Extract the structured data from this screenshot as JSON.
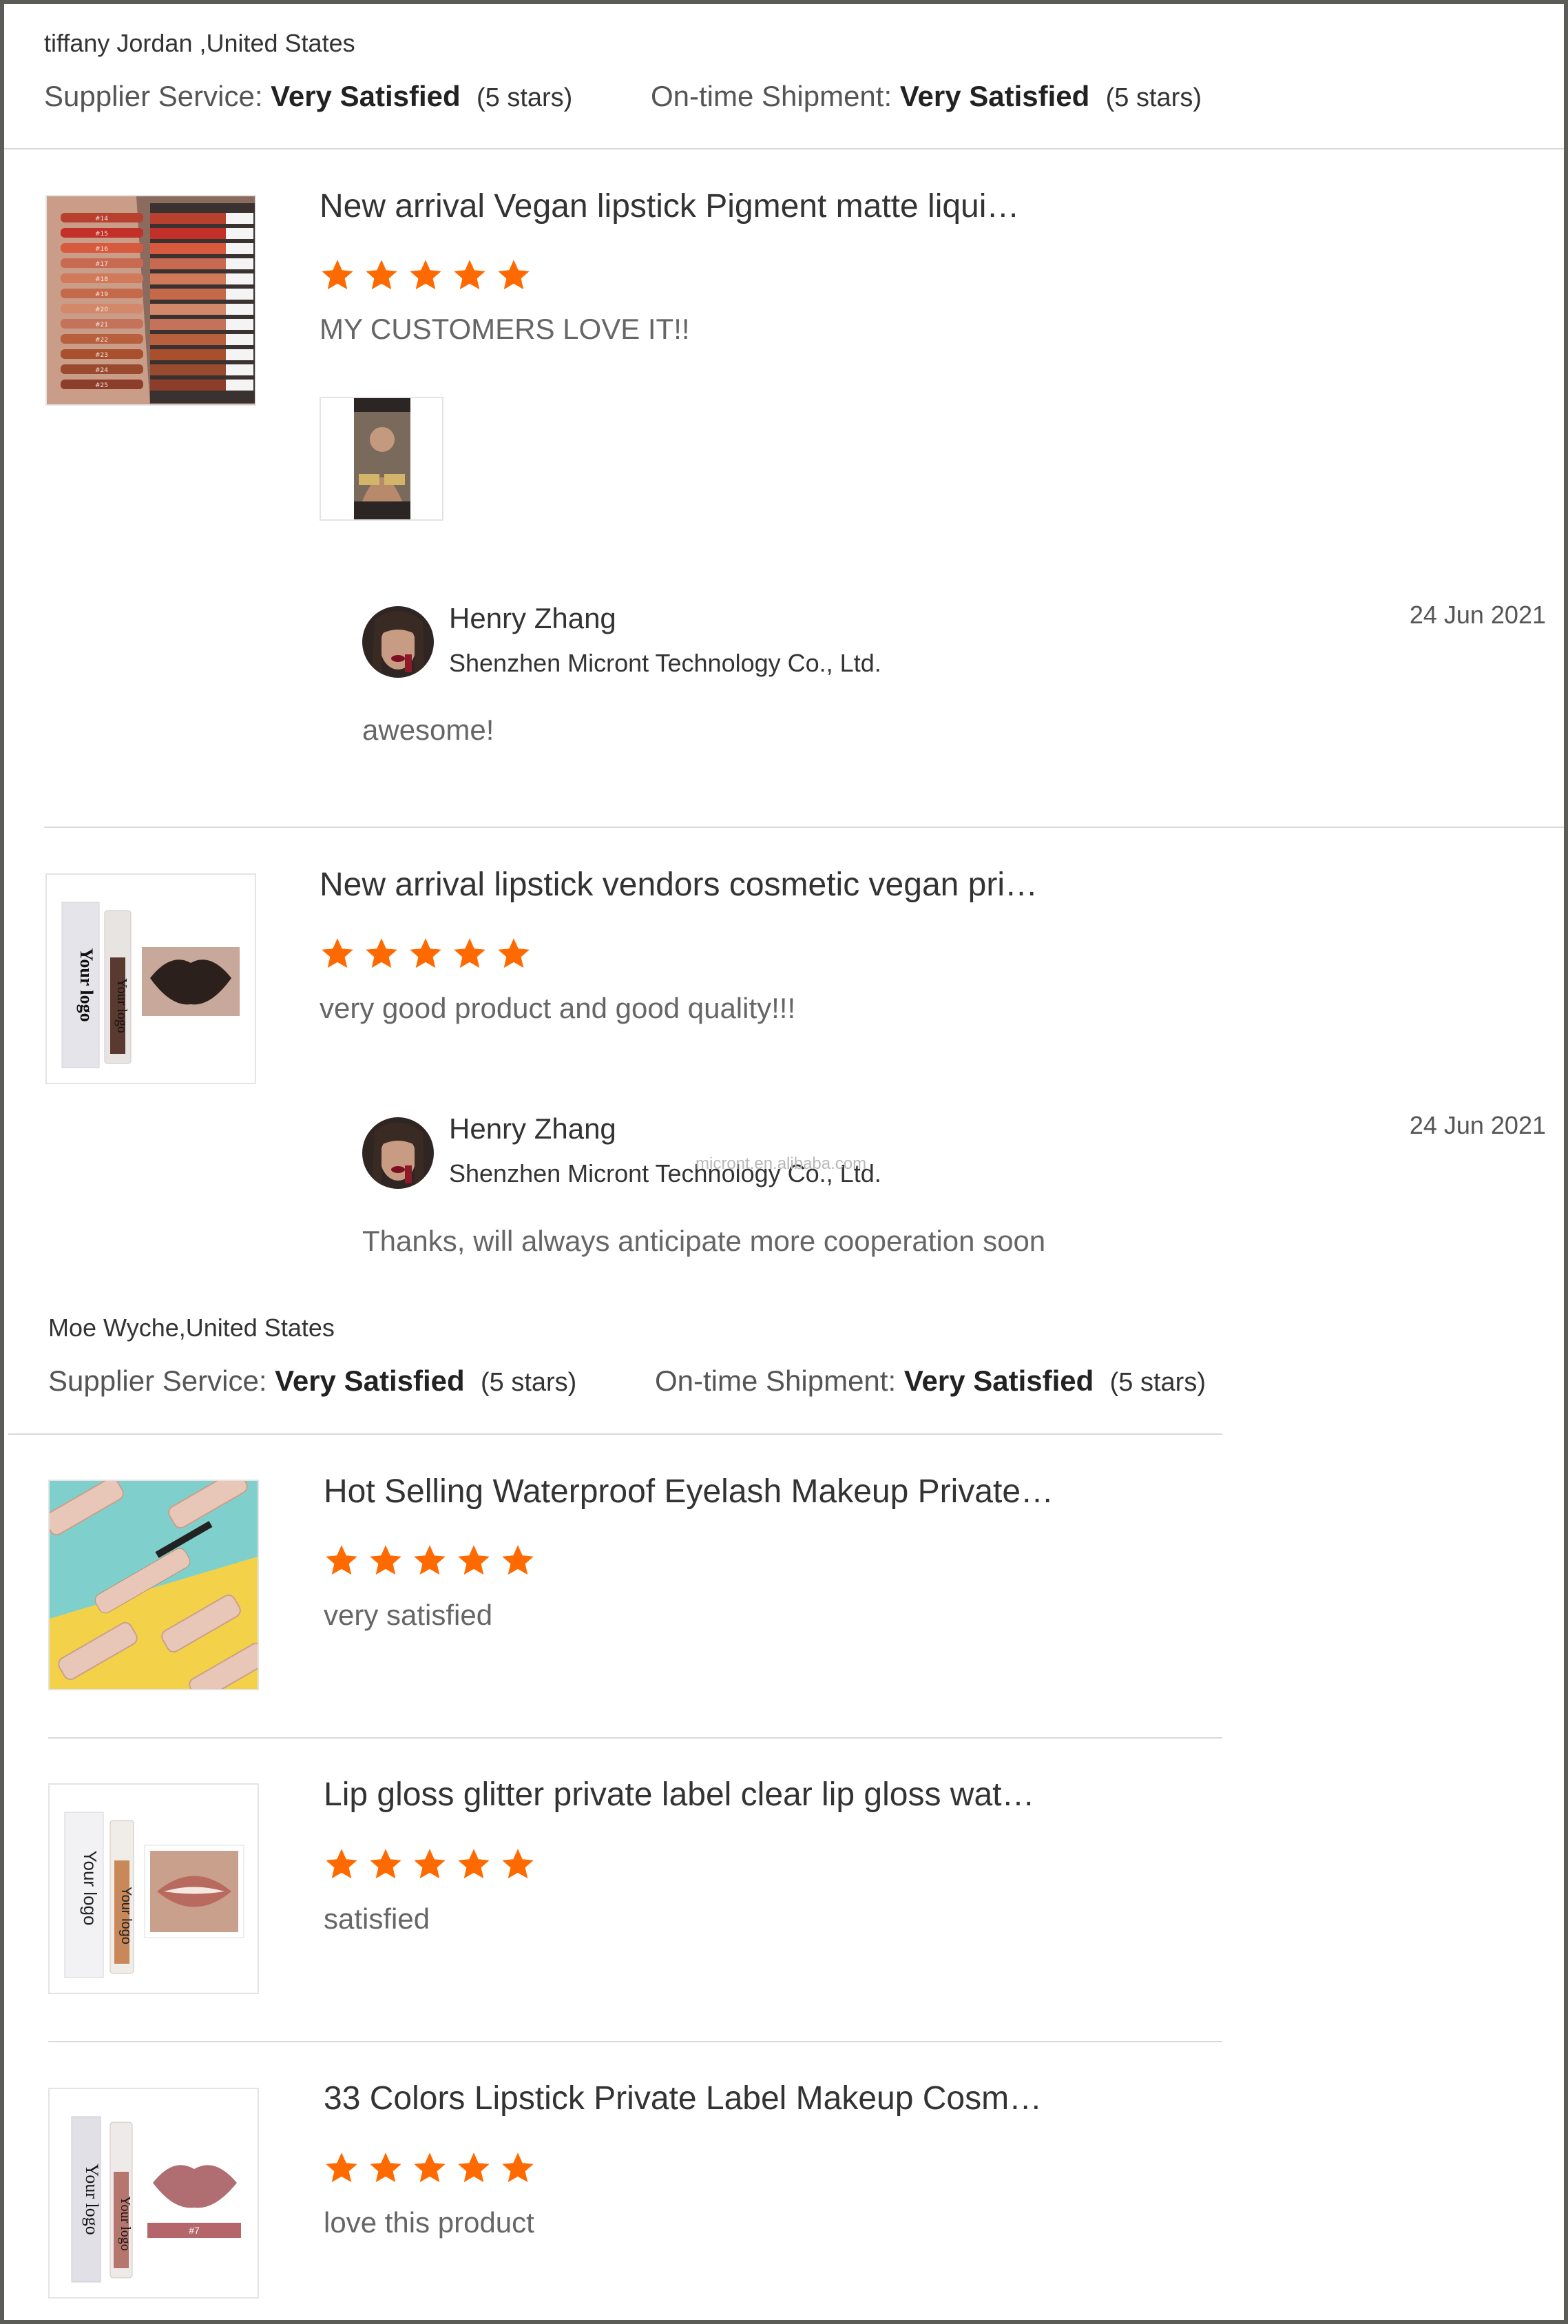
{
  "colors": {
    "star": "#ff6a00",
    "divider": "#d9d9d9",
    "border": "#5b5b58"
  },
  "reviews": [
    {
      "buyer": "tiffany Jordan ,United States",
      "supplier_label": "Supplier Service:",
      "supplier_value": "Very Satisfied",
      "supplier_stars": "(5 stars)",
      "shipment_label": "On-time Shipment:",
      "shipment_value": "Very Satisfied",
      "shipment_stars": "(5 stars)",
      "items": [
        {
          "title": "New arrival Vegan lipstick Pigment matte liqui…",
          "rating": 5,
          "comment": "MY CUSTOMERS LOVE IT!!",
          "reply": {
            "name": "Henry Zhang",
            "company": "Shenzhen Micront Technology Co., Ltd.",
            "date": "24 Jun 2021",
            "text": "awesome!"
          }
        },
        {
          "title": "New arrival lipstick vendors cosmetic vegan pri…",
          "rating": 5,
          "comment": "very good product and good quality!!!",
          "reply": {
            "name": "Henry Zhang",
            "company": "Shenzhen Micront Technology Co., Ltd.",
            "date": "24 Jun 2021",
            "text": "Thanks, will always anticipate more cooperation soon",
            "watermark": "micront.en.alibaba.com"
          }
        }
      ]
    },
    {
      "buyer": "Moe Wyche,United States",
      "supplier_label": "Supplier Service:",
      "supplier_value": "Very Satisfied",
      "supplier_stars": "(5 stars)",
      "shipment_label": "On-time Shipment:",
      "shipment_value": "Very Satisfied",
      "shipment_stars": "(5 stars)",
      "items": [
        {
          "title": "Hot Selling Waterproof Eyelash Makeup Private…",
          "rating": 5,
          "comment": "very satisfied"
        },
        {
          "title": "Lip gloss glitter private label clear lip gloss wat…",
          "rating": 5,
          "comment": "satisfied"
        },
        {
          "title": "33 Colors Lipstick Private Label Makeup Cosm…",
          "rating": 5,
          "comment": "love this product"
        }
      ]
    }
  ],
  "image_text": {
    "logo": "Your logo",
    "swatch_labels": [
      "#14",
      "#15",
      "#16",
      "#17",
      "#18",
      "#19",
      "#20",
      "#21",
      "#22",
      "#23",
      "#24",
      "#25"
    ],
    "shade": "#7"
  }
}
